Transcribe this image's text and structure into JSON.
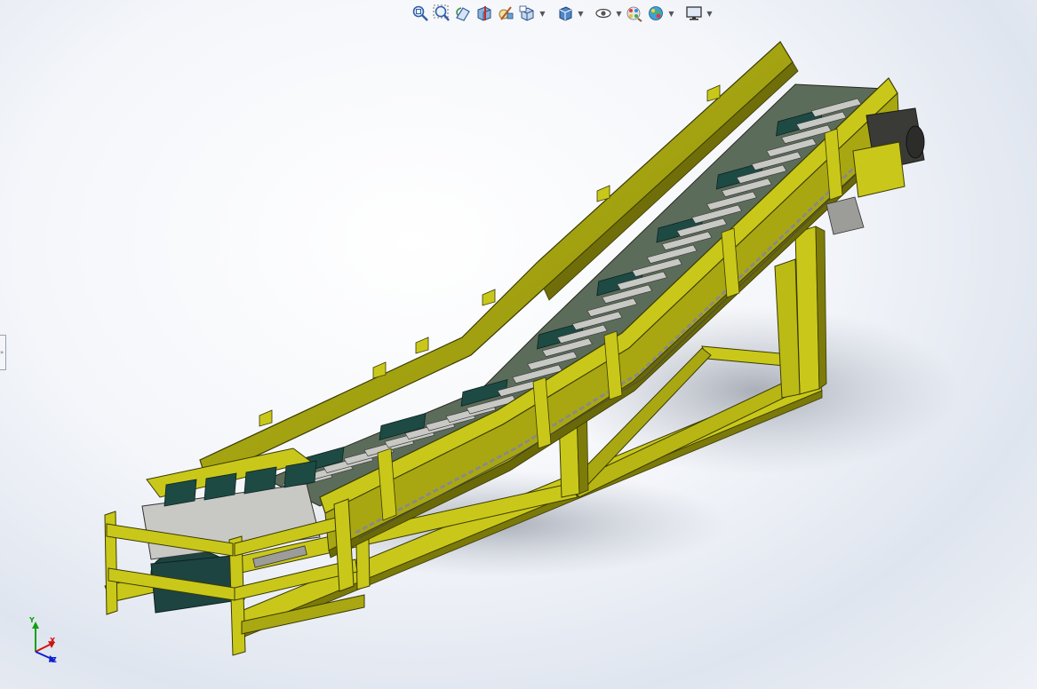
{
  "toolbar": {
    "icons": [
      {
        "name": "zoom-to-fit-icon",
        "has_menu": false
      },
      {
        "name": "zoom-to-area-icon",
        "has_menu": false
      },
      {
        "name": "previous-view-icon",
        "has_menu": false
      },
      {
        "name": "section-view-icon",
        "has_menu": false
      },
      {
        "name": "dynamic-annotation-icon",
        "has_menu": false
      },
      {
        "name": "view-orientation-icon",
        "has_menu": true
      },
      {
        "name": "display-style-icon",
        "has_menu": true
      },
      {
        "name": "hide-show-items-icon",
        "has_menu": true
      },
      {
        "name": "edit-appearance-icon",
        "has_menu": false
      },
      {
        "name": "apply-scene-icon",
        "has_menu": true
      },
      {
        "name": "view-settings-icon",
        "has_menu": true
      }
    ]
  },
  "model": {
    "name": "inclined-slat-conveyor",
    "colors": {
      "frame": "#c9c81a",
      "frame_dark": "#8f8e0c",
      "frame_shadow": "#5f5e06",
      "slat": "#c8c8c4",
      "flight": "#1e4a44",
      "roller": "#1d4440"
    }
  },
  "triad": {
    "x_label": "X",
    "y_label": "Y",
    "z_label": "Z",
    "x_color": "#d01010",
    "y_color": "#10a010",
    "z_color": "#1020d0"
  }
}
